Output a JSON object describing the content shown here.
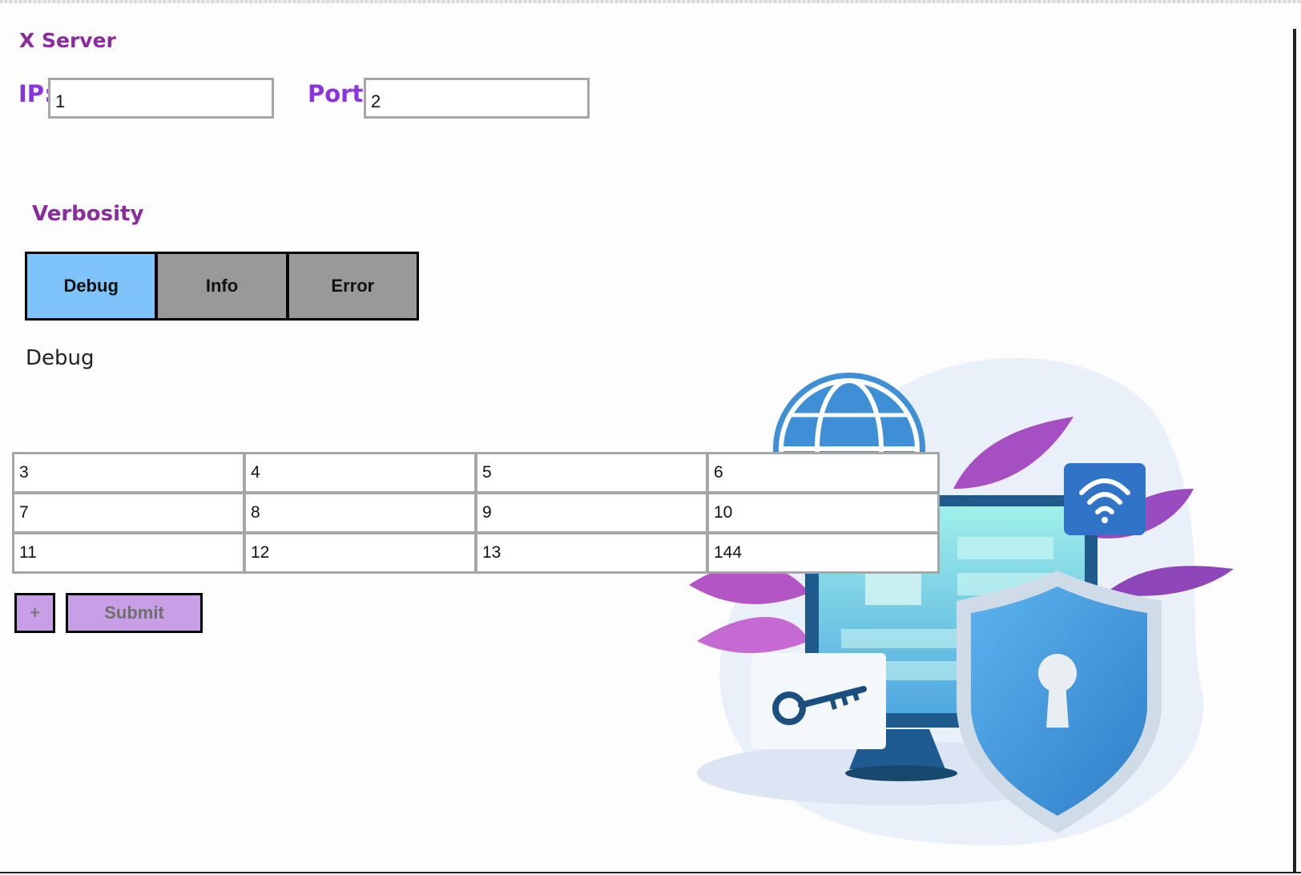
{
  "server": {
    "title": "X Server",
    "ip_label": "IP:",
    "ip_value": "1",
    "port_label": "Port:",
    "port_value": "2"
  },
  "verbosity": {
    "title": "Verbosity",
    "options": [
      "Debug",
      "Info",
      "Error"
    ],
    "selected": "Debug",
    "display_value": "Debug"
  },
  "grid": {
    "rows": [
      [
        "3",
        "4",
        "5",
        "6"
      ],
      [
        "7",
        "8",
        "9",
        "10"
      ],
      [
        "11",
        "12",
        "13",
        "144"
      ]
    ]
  },
  "actions": {
    "add_label": "+",
    "submit_label": "Submit"
  },
  "illustration": {
    "icons": [
      "globe-icon",
      "monitor-icon",
      "wifi-icon",
      "key-icon",
      "shield-lock-icon"
    ]
  },
  "colors": {
    "heading": "#8a2c9e",
    "label": "#8a34e0",
    "active_segment": "#7ec3fa",
    "inactive_segment": "#999999",
    "action_button": "#c89ee6"
  }
}
